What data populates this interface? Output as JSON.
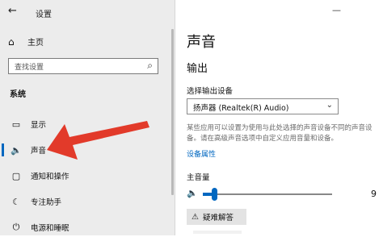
{
  "window": {
    "title": "设置",
    "back_glyph": "←",
    "minimize_glyph": "—"
  },
  "sidebar": {
    "home": {
      "label": "主页",
      "icon": "home-icon",
      "glyph": "⌂"
    },
    "search": {
      "placeholder": "查找设置",
      "icon": "search-icon",
      "glyph": "⌕"
    },
    "group_label": "系统",
    "items": [
      {
        "label": "显示",
        "icon": "monitor-icon",
        "glyph": "▭"
      },
      {
        "label": "声音",
        "icon": "speaker-icon",
        "glyph": "🔈",
        "active": true
      },
      {
        "label": "通知和操作",
        "icon": "notification-icon",
        "glyph": "▢"
      },
      {
        "label": "专注助手",
        "icon": "moon-icon",
        "glyph": "☾"
      },
      {
        "label": "电源和睡眠",
        "icon": "power-icon",
        "glyph": "⏻"
      }
    ]
  },
  "annotation": {
    "arrow_color": "#e23a2a"
  },
  "content": {
    "title": "声音",
    "section": "输出",
    "output_label": "选择输出设备",
    "device_value": "扬声器 (Realtek(R) Audio)",
    "chevron_glyph": "⌄",
    "description": "某些应用可以设置为使用与此处选择的声音设备不同的声音设备。请在高级声音选项中自定义应用音量和设备。",
    "device_props_link": "设备属性",
    "volume_label": "主音量",
    "speaker_glyph": "🔈",
    "volume_value": "9",
    "volume_fraction": 0.09,
    "troubleshoot_label": "疑难解答",
    "warning_glyph": "⚠"
  },
  "colors": {
    "accent": "#0067c0",
    "sidebar_bg": "#ececec"
  }
}
